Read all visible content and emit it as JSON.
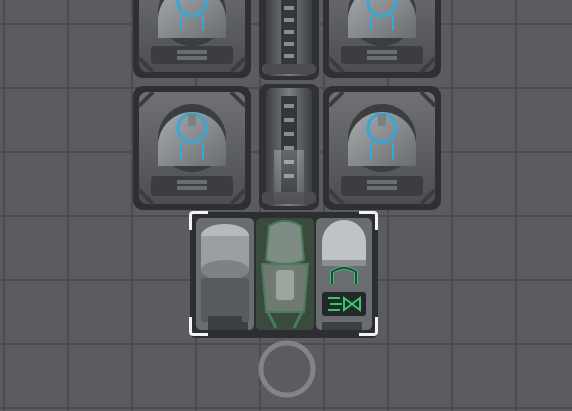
{
  "scene": {
    "type": "top-down station map",
    "floor_color": "#5b5c5f",
    "grid_line_color": "#4b4c4f"
  },
  "storage_units": [
    {
      "id": "storage-unit-top-left",
      "icon": "cryo-pod-icon",
      "accent_color": "#35a7d8"
    },
    {
      "id": "storage-unit-top-right",
      "icon": "cryo-pod-icon",
      "accent_color": "#35a7d8"
    },
    {
      "id": "storage-unit-middle-left",
      "icon": "cryo-pod-icon",
      "accent_color": "#35a7d8"
    },
    {
      "id": "storage-unit-middle-right",
      "icon": "cryo-pod-icon",
      "accent_color": "#35a7d8"
    }
  ],
  "conduit": {
    "icon": "pipe-icon",
    "segments": 2
  },
  "selected_machine": {
    "icon": "suit-storage-icon",
    "selected": true,
    "status_light_color": "#35c86a",
    "selection_color": "#f4f4f4"
  },
  "target_marker": {
    "icon": "ring-marker-icon",
    "color": "#8a8b8e"
  }
}
